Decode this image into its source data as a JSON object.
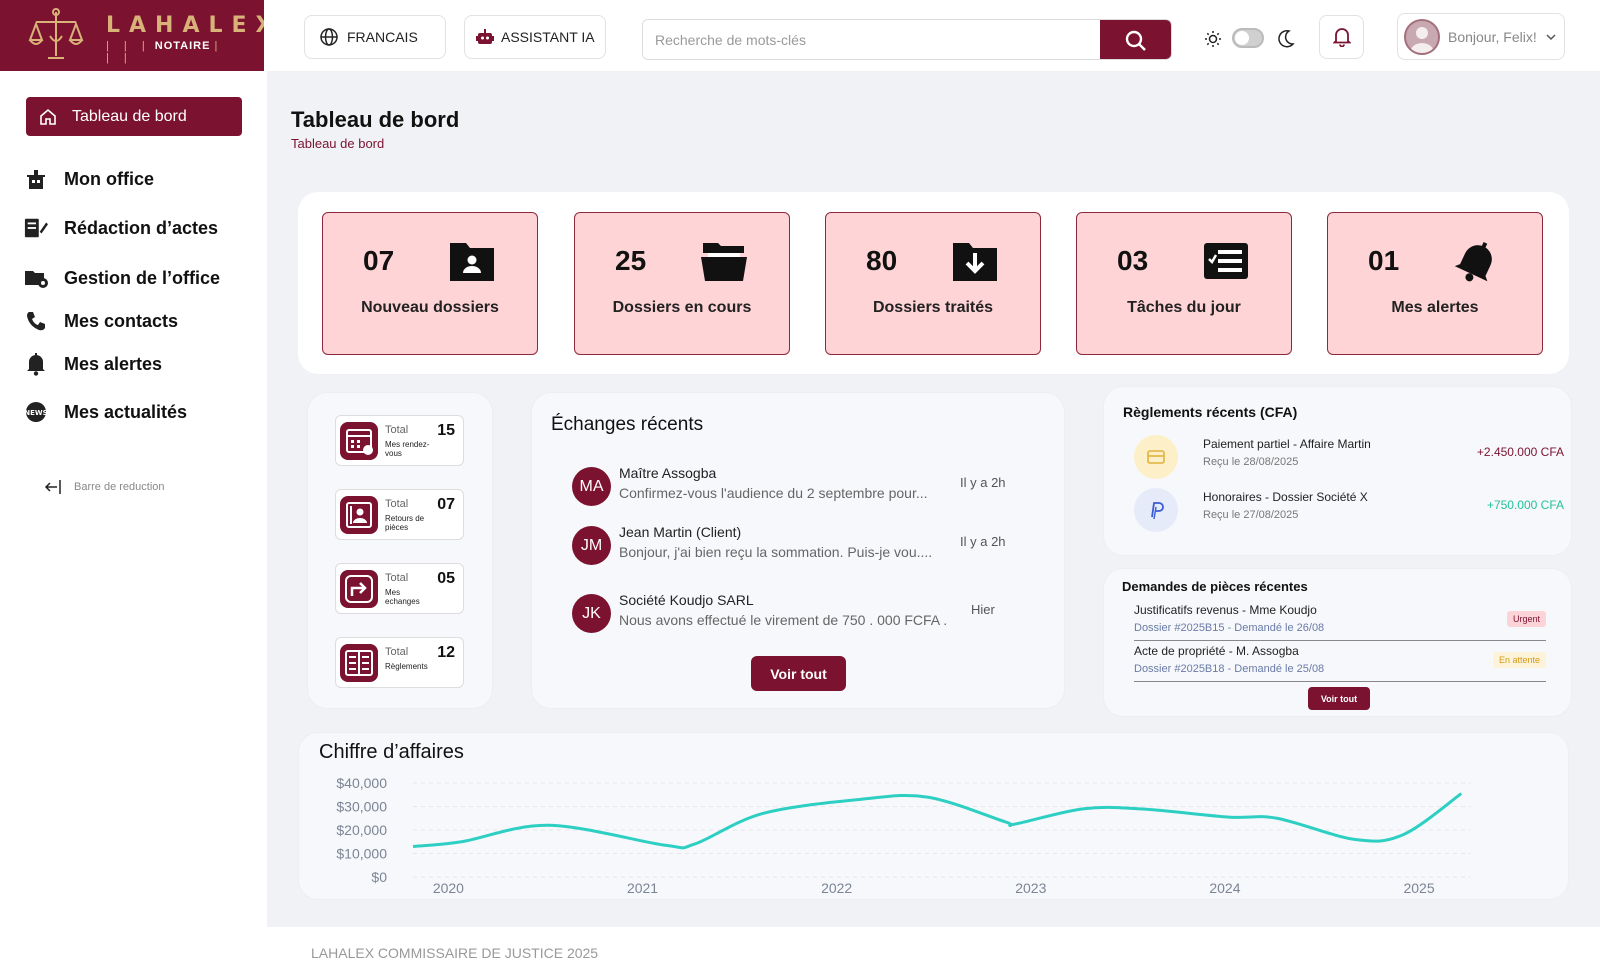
{
  "brand": {
    "name": "LAHALEX",
    "sub": "NOTAIRE"
  },
  "header": {
    "language_label": "FRANCAIS",
    "assistant_label": "ASSISTANT IA",
    "search_placeholder": "Recherche de mots-clés",
    "greeting": "Bonjour, Felix!"
  },
  "sidebar": {
    "active_label": "Tableau de bord",
    "items": [
      {
        "label": "Mon office",
        "icon": "office-icon"
      },
      {
        "label": "Rédaction d’actes",
        "icon": "document-edit-icon"
      },
      {
        "label": "Gestion de l’office",
        "icon": "folder-manage-icon"
      },
      {
        "label": "Mes contacts",
        "icon": "phone-icon"
      },
      {
        "label": "Mes alertes",
        "icon": "bell-alert-icon"
      },
      {
        "label": "Mes actualités",
        "icon": "news-icon"
      }
    ],
    "collapse_label": "Barre de reduction"
  },
  "page": {
    "title": "Tableau de bord",
    "breadcrumb": "Tableau de bord"
  },
  "stats": [
    {
      "value": "07",
      "label": "Nouveau dossiers",
      "icon": "folder-user-icon"
    },
    {
      "value": "25",
      "label": "Dossiers en cours",
      "icon": "folder-open-icon"
    },
    {
      "value": "80",
      "label": "Dossiers traités",
      "icon": "folder-download-icon"
    },
    {
      "value": "03",
      "label": "Tâches du jour",
      "icon": "task-list-icon"
    },
    {
      "value": "01",
      "label": "Mes alertes",
      "icon": "bell-icon"
    }
  ],
  "totals": [
    {
      "title": "Total",
      "sub": "Mes rendez-vous",
      "value": "15",
      "icon": "calendar-icon"
    },
    {
      "title": "Total",
      "sub": "Retours de pièces",
      "value": "07",
      "icon": "contact-card-icon"
    },
    {
      "title": "Total",
      "sub": "Mes echanges",
      "value": "05",
      "icon": "exchange-icon"
    },
    {
      "title": "Total",
      "sub": "Règlements",
      "value": "12",
      "icon": "ledger-icon"
    }
  ],
  "exchanges": {
    "title": "Échanges récents",
    "items": [
      {
        "initials": "MA",
        "name": "Maître Assogba",
        "text": "Confirmez-vous l'audience du 2 septembre pour...",
        "time": "Il y a 2h"
      },
      {
        "initials": "JM",
        "name": "Jean Martin (Client)",
        "text": "Bonjour, j'ai bien reçu la sommation. Puis-je vou....",
        "time": "Il y a 2h"
      },
      {
        "initials": "JK",
        "name": "Société Koudjo SARL",
        "text": "Nous avons effectué le virement de 750 . 000 FCFA .",
        "time": "Hier"
      }
    ],
    "button": "Voir tout"
  },
  "payments": {
    "title": "Règlements récents (CFA)",
    "items": [
      {
        "name": "Paiement partiel - Affaire Martin",
        "date": "Reçu le 28/08/2025",
        "amount": "+2.450.000 CFA",
        "color": "#7b1230",
        "icon": "card-icon"
      },
      {
        "name": "Honoraires - Dossier Société X",
        "date": "Reçu le 27/08/2025",
        "amount": "+750.000 CFA",
        "color": "#22c29a",
        "icon": "paypal-icon"
      }
    ]
  },
  "requests": {
    "title": "Demandes de pièces récentes",
    "items": [
      {
        "name": "Justificatifs revenus - Mme Koudjo",
        "detail": "Dossier #2025B15 - Demandé le 26/08",
        "badge": "Urgent"
      },
      {
        "name": "Acte de propriété - M. Assogba",
        "detail": "Dossier #2025B18 - Demandé le 25/08",
        "badge": "En attente"
      }
    ],
    "button": "Voir tout"
  },
  "footer": "LAHALEX COMMISSAIRE DE JUSTICE 2025",
  "colors": {
    "accent": "#7b1230",
    "stat_bg": "#ffd4d6",
    "line": "#2ecfc3"
  },
  "chart_data": {
    "type": "line",
    "title": "Chiffre d’affaires",
    "x_tick_labels": [
      "2020",
      "2021",
      "2022",
      "2023",
      "2024",
      "2025"
    ],
    "y_tick_labels": [
      "$40,000",
      "$30,000",
      "$20,000",
      "$10,000",
      "$0"
    ],
    "ylim": [
      0,
      40000
    ],
    "xlim": [
      2019.9,
      2025.35
    ],
    "series": [
      {
        "x": [
          2019.9,
          2020.15,
          2020.6,
          2021.2,
          2021.35,
          2021.7,
          2022.2,
          2022.55,
          2022.95,
          2023.0,
          2023.35,
          2023.65,
          2024.1,
          2024.35,
          2024.75,
          2025.0,
          2025.3
        ],
        "values": [
          13000,
          15000,
          22000,
          13500,
          14000,
          27000,
          33000,
          34000,
          23500,
          22500,
          29000,
          29000,
          25500,
          25000,
          16000,
          18000,
          35500
        ]
      }
    ],
    "grid": true
  }
}
